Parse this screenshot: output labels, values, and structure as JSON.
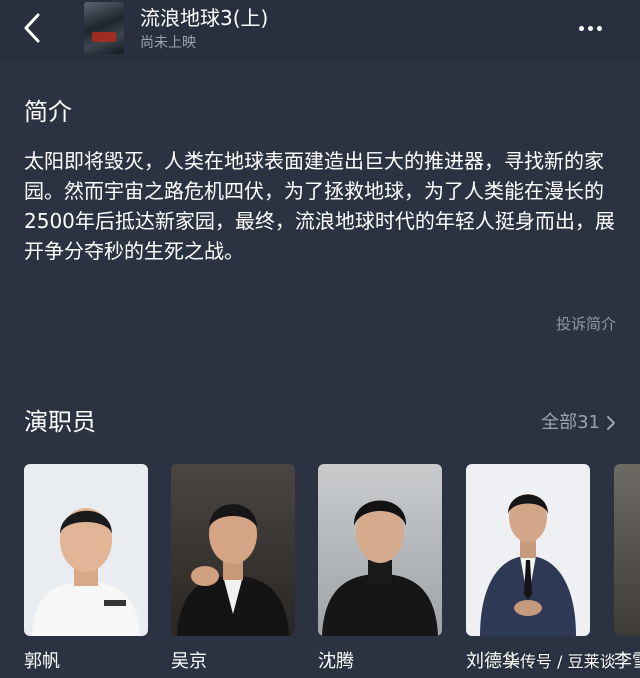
{
  "header": {
    "back_icon": "chevron-left-icon",
    "title": "流浪地球3(上)",
    "status": "尚未上映",
    "more_icon": "more-horizontal-icon"
  },
  "synopsis": {
    "heading": "简介",
    "text": "太阳即将毁灭，人类在地球表面建造出巨大的推进器，寻找新的家园。然而宇宙之路危机四伏，为了拯救地球，为了人类能在漫长的2500年后抵达新家园，最终，流浪地球时代的年轻人挺身而出，展开争分夺秒的生死之战。",
    "report_label": "投诉简介"
  },
  "cast": {
    "heading": "演职员",
    "all_label": "全部31",
    "all_icon": "chevron-right-icon",
    "members": [
      {
        "name": "郭帆"
      },
      {
        "name": "吴京"
      },
      {
        "name": "沈腾"
      },
      {
        "name": "刘德华"
      },
      {
        "name": "李雪"
      }
    ]
  },
  "watermark": "头传号 / 豆莱谈",
  "colors": {
    "background": "#2b3343",
    "text_primary": "#ffffff",
    "text_secondary": "#9aa3b2"
  }
}
